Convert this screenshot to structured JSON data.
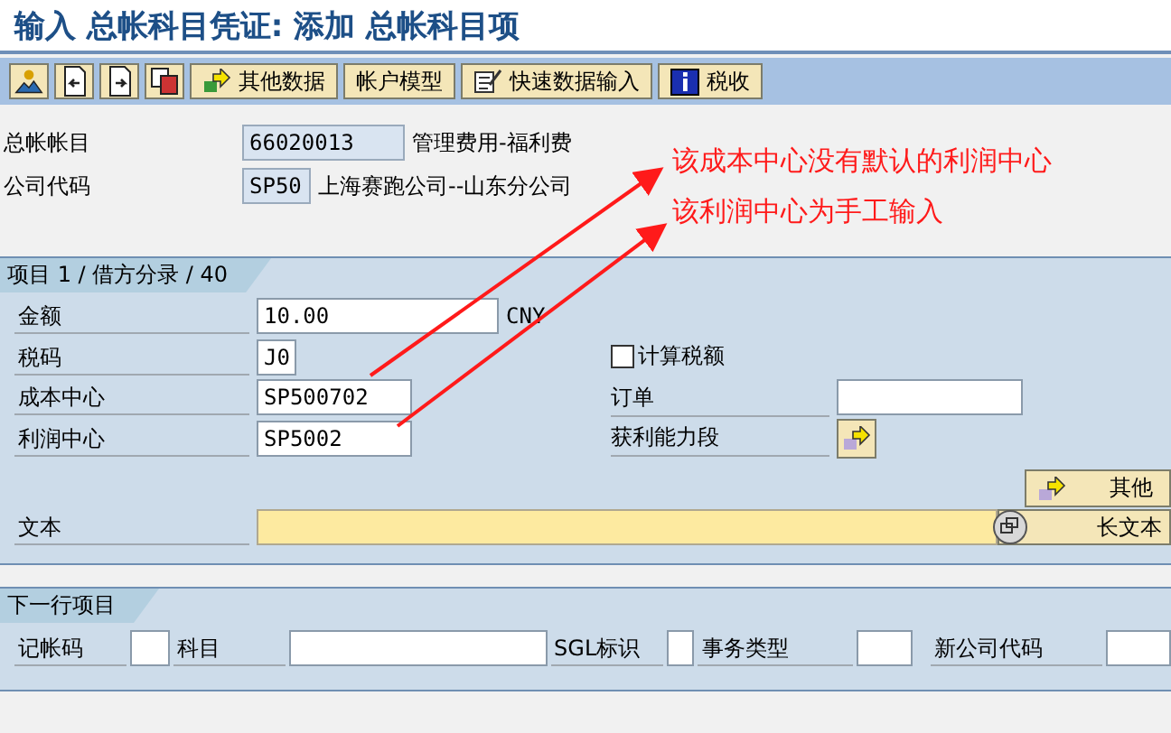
{
  "title": "输入 总帐科目凭证: 添加 总帐科目项",
  "toolbar": [
    {
      "kind": "icon"
    },
    {
      "kind": "icon"
    },
    {
      "kind": "icon"
    },
    {
      "kind": "icon"
    },
    {
      "kind": "button",
      "label": "其他数据"
    },
    {
      "kind": "button",
      "label": "帐户模型"
    },
    {
      "kind": "button",
      "label": "快速数据输入"
    },
    {
      "kind": "button",
      "label": "税收"
    }
  ],
  "header": [
    {
      "label": "总帐帐目",
      "value": "66020013",
      "description": "管理费用-福利费"
    },
    {
      "label": "公司代码",
      "value": "SP50",
      "description": "上海赛跑公司--山东分公司"
    }
  ],
  "item": {
    "title": "项目 1 / 借方分录 / 40",
    "amount": {
      "label": "金额",
      "value": "10.00",
      "unit": "CNY"
    },
    "tax_code": {
      "label": "税码",
      "value": "J0"
    },
    "calc_tax": {
      "label": "计算税额",
      "checked": false
    },
    "cost_center": {
      "label": "成本中心",
      "value": "SP500702"
    },
    "order": {
      "label": "订单"
    },
    "profit_center": {
      "label": "利润中心",
      "value": "SP5002"
    },
    "profitability_segment": {
      "label": "获利能力段"
    },
    "more_button": "其他",
    "text": {
      "label": "文本"
    },
    "long_text_button": "长文本"
  },
  "next_item": {
    "title": "下一行项目",
    "fields": [
      {
        "label": "记帐码"
      },
      {
        "label": "科目"
      },
      {
        "label": "SGL标识"
      },
      {
        "label": "事务类型"
      },
      {
        "label": "新公司代码"
      }
    ]
  },
  "annotations": [
    "该成本中心没有默认的利润中心",
    "该利润中心为手工输入"
  ]
}
